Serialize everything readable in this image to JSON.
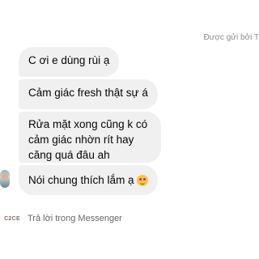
{
  "header": {
    "sent_by": "Được gửi bởi T"
  },
  "messages": [
    {
      "text": "C ơi e dùng rùi ạ"
    },
    {
      "text": "Cảm giác fresh thật sự á"
    },
    {
      "text": "Rửa mặt xong cũng k có cảm giác nhờn rít hay căng quá đâu ah"
    },
    {
      "text": "Nói chung thích lắm ạ",
      "emoji": "smiling-face-with-hearts-icon"
    }
  ],
  "footer": {
    "logo_text": "C2CE",
    "reply_label": "Trả lời trong Messenger"
  }
}
